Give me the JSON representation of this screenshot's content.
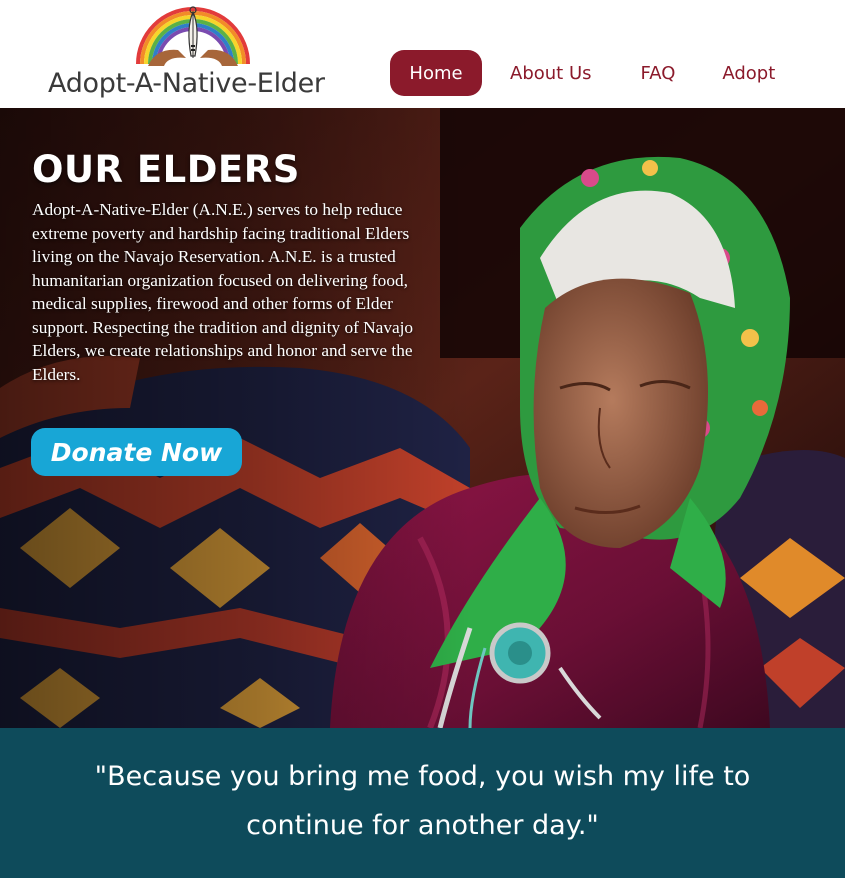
{
  "header": {
    "logo_text": "Adopt-A-Native-Elder",
    "nav": [
      {
        "label": "Home",
        "active": true
      },
      {
        "label": "About Us",
        "active": false
      },
      {
        "label": "FAQ",
        "active": false
      },
      {
        "label": "Adopt",
        "active": false
      }
    ]
  },
  "hero": {
    "title": "OUR ELDERS",
    "body": "Adopt-A-Native-Elder (A.N.E.) serves to help reduce extreme poverty and hardship facing traditional Elders living on the Navajo Reservation. A.N.E. is a trusted humanitarian organization focused on delivering food, medical supplies, firewood and other forms of Elder support. Respecting the tradition and dignity of Navajo Elders, we create relationships and honor and serve the Elders.",
    "donate_label": "Donate Now",
    "image_alt": "photo-elder-woman-in-headscarf-and-blanket"
  },
  "quote": {
    "text": "\"Because you bring me food, you wish my life to continue for another day.\""
  },
  "colors": {
    "brand_maroon": "#8b1a2b",
    "donate_blue": "#18a6d6",
    "quote_teal": "#0e4b5b",
    "logo_text": "#3a3a3a"
  },
  "icons": {
    "logo": "rainbow-feather-hands-logo"
  }
}
